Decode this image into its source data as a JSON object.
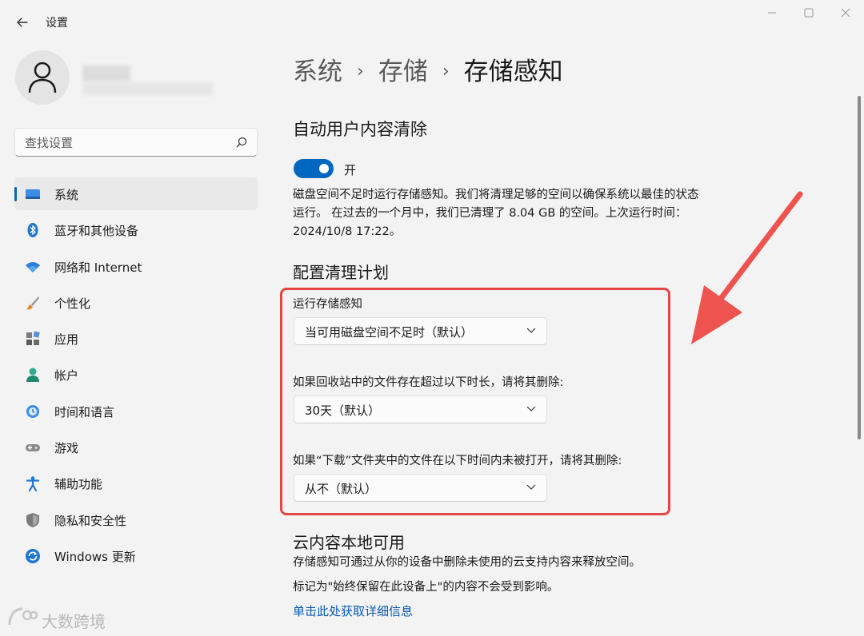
{
  "window": {
    "title": "设置"
  },
  "sidebar": {
    "search_placeholder": "查找设置",
    "items": [
      {
        "label": "系统",
        "icon": "system-display-icon",
        "active": true
      },
      {
        "label": "蓝牙和其他设备",
        "icon": "bluetooth-icon"
      },
      {
        "label": "网络和 Internet",
        "icon": "wifi-icon"
      },
      {
        "label": "个性化",
        "icon": "paintbrush-icon"
      },
      {
        "label": "应用",
        "icon": "apps-icon"
      },
      {
        "label": "帐户",
        "icon": "account-icon"
      },
      {
        "label": "时间和语言",
        "icon": "time-language-icon"
      },
      {
        "label": "游戏",
        "icon": "gamepad-icon"
      },
      {
        "label": "辅助功能",
        "icon": "accessibility-icon"
      },
      {
        "label": "隐私和安全性",
        "icon": "shield-icon"
      },
      {
        "label": "Windows 更新",
        "icon": "update-icon"
      }
    ]
  },
  "breadcrumb": [
    "系统",
    "存储",
    "存储感知"
  ],
  "main": {
    "auto_cleanup": {
      "heading": "自动用户内容清除",
      "toggle_state": "开",
      "description": "磁盘空间不足时运行存储感知。我们将清理足够的空间以确保系统以最佳的状态运行。 在过去的一个月中，我们已清理了 8.04 GB 的空间。上次运行时间：2024/10/8 17:22。"
    },
    "schedule": {
      "heading": "配置清理计划",
      "run_label": "运行存储感知",
      "run_value": "当可用磁盘空间不足时（默认）",
      "recycle_label": "如果回收站中的文件存在超过以下时长，请将其删除:",
      "recycle_value": "30天（默认）",
      "downloads_label": "如果“下载”文件夹中的文件在以下时间内未被打开，请将其删除:",
      "downloads_value": "从不（默认）"
    },
    "cloud": {
      "heading": "云内容本地可用",
      "line1": "存储感知可通过从你的设备中删除未使用的云支持内容来释放空间。",
      "line2": "标记为\"始终保留在此设备上\"的内容不会受到影响。",
      "link": "单击此处获取详细信息"
    }
  },
  "watermark": "大数跨境",
  "colors": {
    "accent": "#0067c0",
    "highlight": "#e54545",
    "arrow": "#ef5350"
  }
}
